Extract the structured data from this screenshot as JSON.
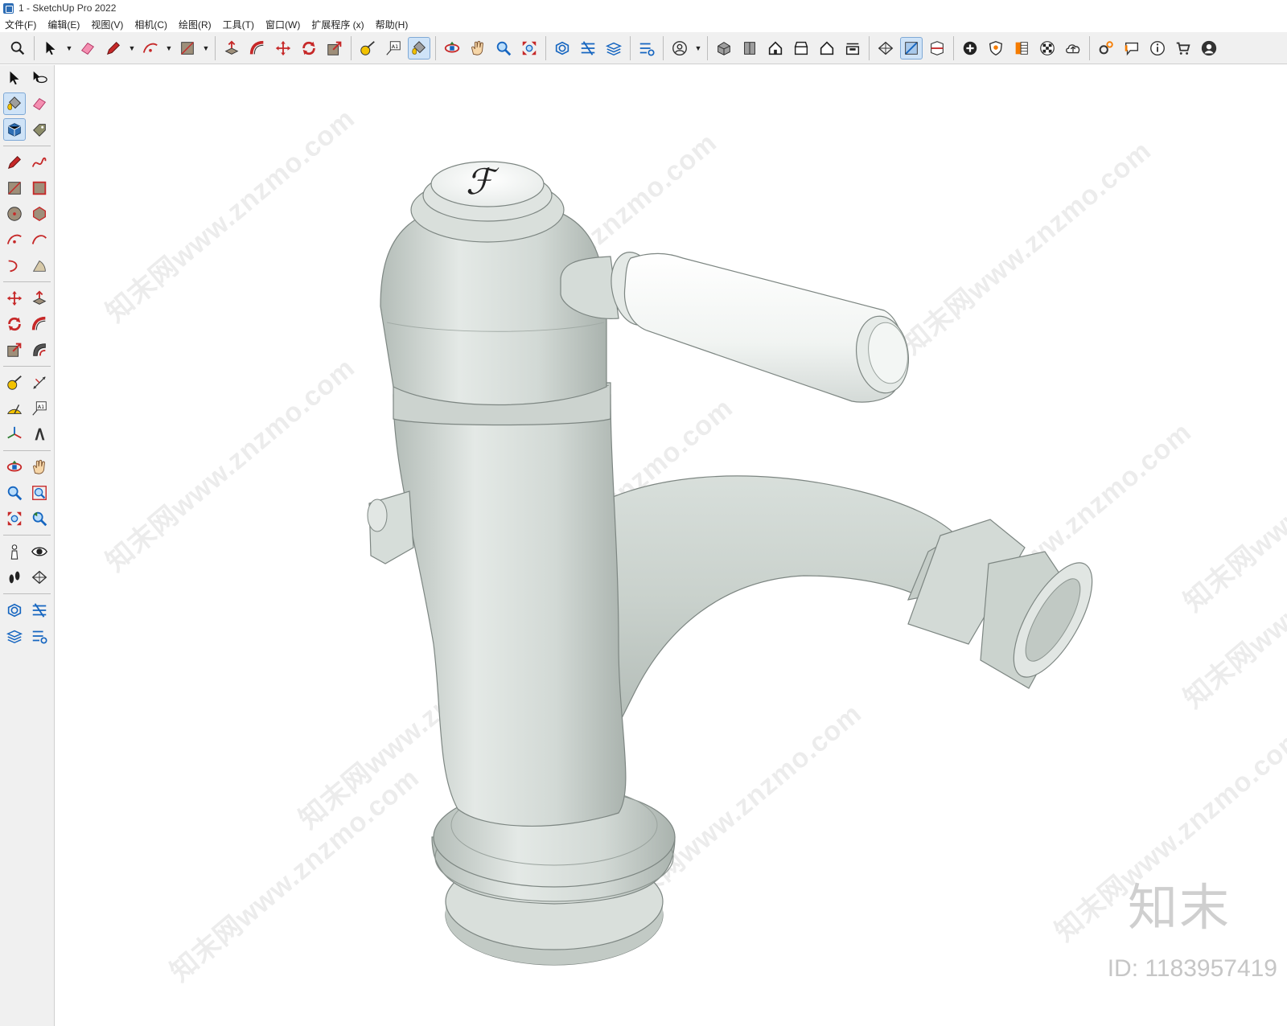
{
  "window": {
    "title": "1 - SketchUp Pro 2022"
  },
  "menu": [
    "文件(F)",
    "编辑(E)",
    "视图(V)",
    "相机(C)",
    "绘图(R)",
    "工具(T)",
    "窗口(W)",
    "扩展程序 (x)",
    "帮助(H)"
  ],
  "toolbar": {
    "groups": [
      [
        "search-icon"
      ],
      [
        "select-arrow-icon",
        "dropdown",
        "eraser-icon",
        "pencil-icon",
        "dropdown",
        "arc-icon",
        "dropdown",
        "rectangle-icon",
        "dropdown"
      ],
      [
        "push-pull-icon",
        "follow-me-icon",
        "move-icon",
        "rotate-icon",
        "scale-icon"
      ],
      [
        "tape-measure-icon",
        "text-label-icon",
        "paint-bucket-icon"
      ],
      [
        "orbit-icon",
        "pan-hand-icon",
        "zoom-icon",
        "zoom-extents-icon"
      ],
      [
        "3d-warehouse-icon",
        "extension-warehouse-icon",
        "layout-icon"
      ],
      [
        "extension-manager-icon"
      ],
      [
        "account-icon",
        "dropdown"
      ],
      [
        "iso-view-icon",
        "top-view-icon",
        "front-view-icon",
        "right-view-icon",
        "back-view-icon",
        "left-view-icon"
      ],
      [
        "section-plane-icon",
        "section-fill-icon",
        "section-cut-icon"
      ],
      [
        "add-location-icon",
        "shield-icon",
        "materials-icon",
        "checker-icon",
        "cloud-upload-icon"
      ],
      [
        "gears-icon",
        "speech-bubble-icon",
        "info-icon",
        "cart-icon",
        "user-icon"
      ]
    ],
    "active": [
      "paint-bucket-icon",
      "section-fill-icon"
    ]
  },
  "left_toolbar": {
    "rows": [
      [
        "select-arrow-icon",
        "orbit-select-icon"
      ],
      [
        "paint-bucket-icon",
        "eraser-icon"
      ],
      [
        "component-icon",
        "tag-icon"
      ],
      "separator",
      [
        "pencil-icon",
        "freehand-icon"
      ],
      [
        "rectangle-icon",
        "rotated-rectangle-icon"
      ],
      [
        "circle-icon",
        "polygon-icon"
      ],
      [
        "arc-icon",
        "two-point-arc-icon"
      ],
      [
        "three-point-arc-icon",
        "pie-icon"
      ],
      "separator",
      [
        "move-icon",
        "push-pull-icon"
      ],
      [
        "rotate-icon",
        "follow-me-icon"
      ],
      [
        "scale-icon",
        "offset-icon"
      ],
      "separator",
      [
        "tape-measure-icon",
        "dimension-icon"
      ],
      [
        "protractor-icon",
        "text-label-icon"
      ],
      [
        "axes-icon",
        "3d-text-icon"
      ],
      "separator",
      [
        "orbit-icon",
        "pan-hand-icon"
      ],
      [
        "zoom-icon",
        "zoom-window-icon"
      ],
      [
        "zoom-extents-icon",
        "previous-view-icon"
      ],
      "separator",
      [
        "position-camera-icon",
        "look-around-icon"
      ],
      [
        "walk-icon",
        "section-plane-icon"
      ],
      "separator",
      [
        "3d-warehouse-icon",
        "extension-warehouse-icon"
      ],
      [
        "layout-icon",
        "extension-manager-icon"
      ]
    ],
    "active": [
      "paint-bucket-icon",
      "component-icon"
    ]
  },
  "viewport": {
    "watermark_text": "知末网www.znzmo.com",
    "brand_logo": "知末",
    "brand_id": "ID: 1183957419",
    "handle_emblem": "ℱ"
  },
  "colors": {
    "faucet_body": "#dde3df",
    "faucet_shadow": "#b7c0bb",
    "handle_white": "#f7f9f8",
    "toolbar_bg": "#f0f0f0",
    "active_bg": "#cfe3f7"
  }
}
